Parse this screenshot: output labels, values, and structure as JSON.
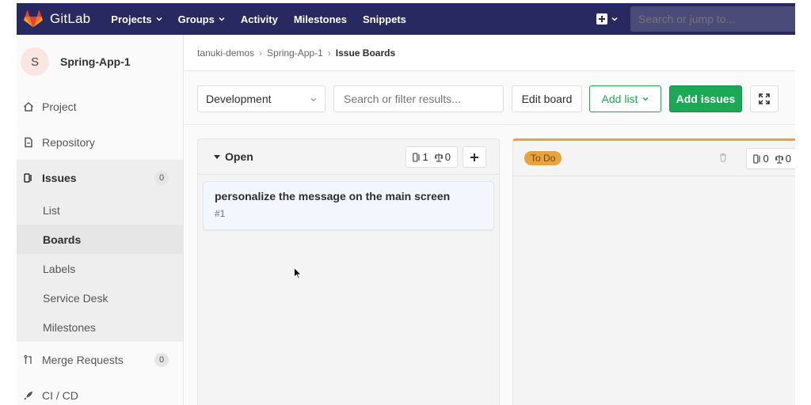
{
  "navbar": {
    "brand": "GitLab",
    "links": [
      {
        "label": "Projects",
        "has_dropdown": true
      },
      {
        "label": "Groups",
        "has_dropdown": true
      },
      {
        "label": "Activity",
        "has_dropdown": false
      },
      {
        "label": "Milestones",
        "has_dropdown": false
      },
      {
        "label": "Snippets",
        "has_dropdown": false
      }
    ],
    "search_placeholder": "Search or jump to...",
    "bg_color": "#292961",
    "icons": {
      "logo": "gitlab-tanuki-icon",
      "new": "plus-square-icon"
    }
  },
  "sidebar": {
    "project_avatar_letter": "S",
    "project_name": "Spring-App-1",
    "items": {
      "project": "Project",
      "repository": "Repository",
      "issues": "Issues",
      "issues_count": "0",
      "merge_requests": "Merge Requests",
      "mr_count": "0",
      "cicd": "CI / CD"
    },
    "issues_sub": [
      "List",
      "Boards",
      "Labels",
      "Service Desk",
      "Milestones"
    ],
    "active_sub": "Boards"
  },
  "breadcrumb": {
    "group": "tanuki-demos",
    "project": "Spring-App-1",
    "current": "Issue Boards"
  },
  "toolbar": {
    "board_select": "Development",
    "filter_placeholder": "Search or filter results...",
    "edit_board": "Edit board",
    "add_list": "Add list",
    "add_issues": "Add issues"
  },
  "lists": {
    "open": {
      "title": "Open",
      "issue_count": "1",
      "weight": "0",
      "cards": [
        {
          "title": "personalize the message on the main screen",
          "ref": "#1"
        }
      ]
    },
    "todo": {
      "label": "To Do",
      "label_color": "#e8a33c",
      "issue_count": "0",
      "weight": "0"
    }
  },
  "colors": {
    "accent_green": "#1aaa55",
    "todo_orange": "#e8a33c"
  }
}
